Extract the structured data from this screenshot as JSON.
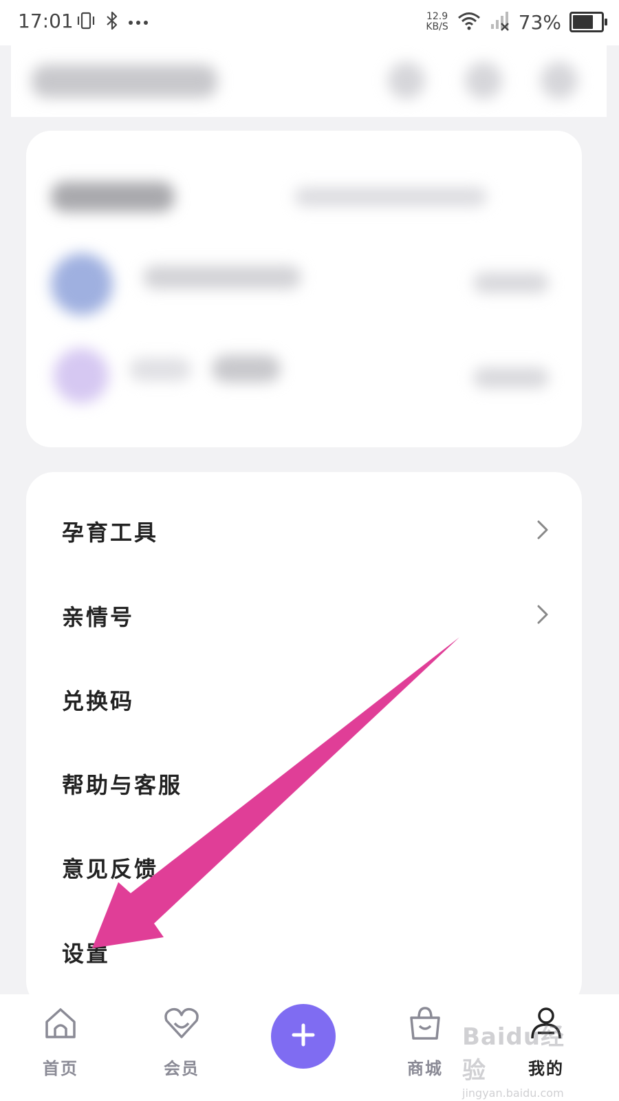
{
  "status_bar": {
    "time": "17:01",
    "net_speed_value": "12.9",
    "net_speed_unit": "KB/S",
    "battery_percent": "73%",
    "battery_level": 0.73,
    "icons": [
      "vibrate-icon",
      "bluetooth-icon",
      "more-dots-icon",
      "wifi-icon",
      "signal-icon",
      "battery-icon"
    ]
  },
  "menu": {
    "items": [
      {
        "label": "孕育工具",
        "has_chevron": true
      },
      {
        "label": "亲情号",
        "has_chevron": true
      },
      {
        "label": "兑换码",
        "has_chevron": false
      },
      {
        "label": "帮助与客服",
        "has_chevron": false
      },
      {
        "label": "意见反馈",
        "has_chevron": false
      },
      {
        "label": "设置",
        "has_chevron": false
      }
    ]
  },
  "tab_bar": {
    "tabs": [
      {
        "label": "首页",
        "icon": "home-icon",
        "active": false
      },
      {
        "label": "会员",
        "icon": "heart-icon",
        "active": false
      },
      {
        "label": "商城",
        "icon": "shopping-bag-icon",
        "active": false
      },
      {
        "label": "我的",
        "icon": "profile-icon",
        "active": true
      }
    ],
    "center_button_icon": "plus-icon"
  },
  "watermark": {
    "brand": "Baidu经验",
    "url": "jingyan.baidu.com"
  },
  "colors": {
    "accent": "#7f6cf2",
    "annotation_arrow": "#e03e97",
    "background": "#f2f2f4"
  }
}
